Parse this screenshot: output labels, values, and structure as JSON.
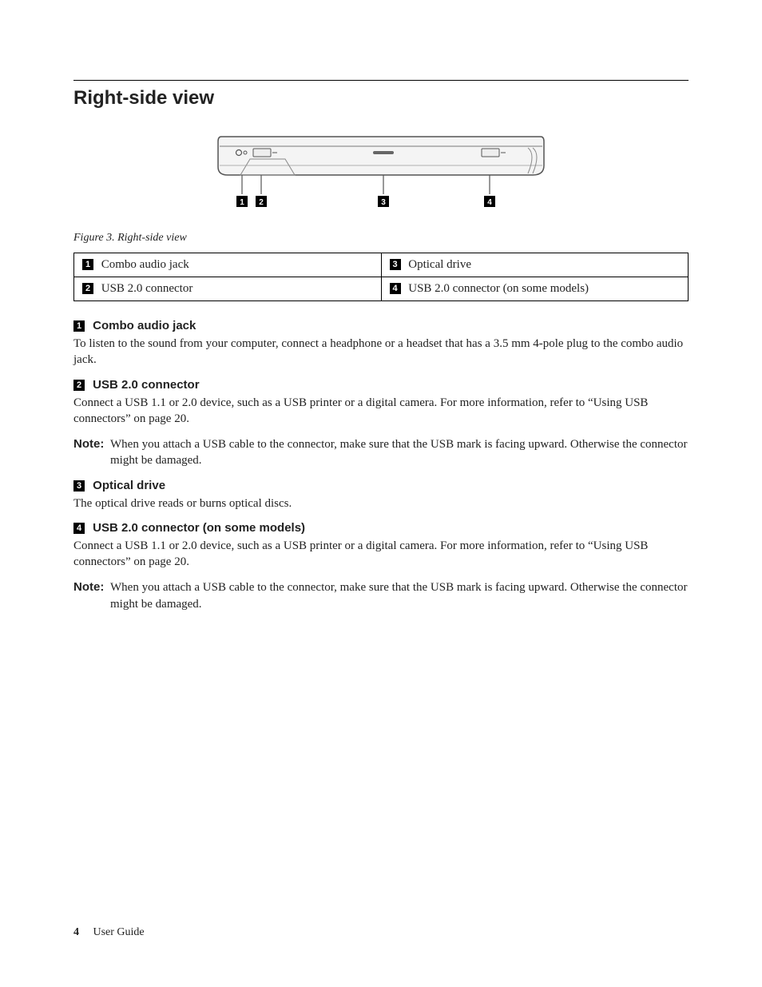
{
  "section_title": "Right-side view",
  "figure": {
    "caption": "Figure 3. Right-side view",
    "callouts": [
      "1",
      "2",
      "3",
      "4"
    ]
  },
  "callout_table": {
    "cells": [
      {
        "num": "1",
        "label": "Combo audio jack"
      },
      {
        "num": "3",
        "label": "Optical drive"
      },
      {
        "num": "2",
        "label": "USB 2.0 connector"
      },
      {
        "num": "4",
        "label": "USB 2.0 connector (on some models)"
      }
    ]
  },
  "items": {
    "i1": {
      "num": "1",
      "heading": "Combo audio jack",
      "body": "To listen to the sound from your computer, connect a headphone or a headset that has a 3.5 mm 4-pole plug to the combo audio jack."
    },
    "i2": {
      "num": "2",
      "heading": "USB 2.0 connector",
      "body": "Connect a USB 1.1 or 2.0 device, such as a USB printer or a digital camera. For more information, refer to “Using USB connectors” on page 20.",
      "note_label": "Note:",
      "note_text": "When you attach a USB cable to the connector, make sure that the USB mark is facing upward. Otherwise the connector might be damaged."
    },
    "i3": {
      "num": "3",
      "heading": "Optical drive",
      "body": "The optical drive reads or burns optical discs."
    },
    "i4": {
      "num": "4",
      "heading": "USB 2.0 connector (on some models)",
      "body": "Connect a USB 1.1 or 2.0 device, such as a USB printer or a digital camera. For more information, refer to “Using USB connectors” on page 20.",
      "note_label": "Note:",
      "note_text": "When you attach a USB cable to the connector, make sure that the USB mark is facing upward. Otherwise the connector might be damaged."
    }
  },
  "footer": {
    "page_number": "4",
    "doc_title": "User Guide"
  }
}
